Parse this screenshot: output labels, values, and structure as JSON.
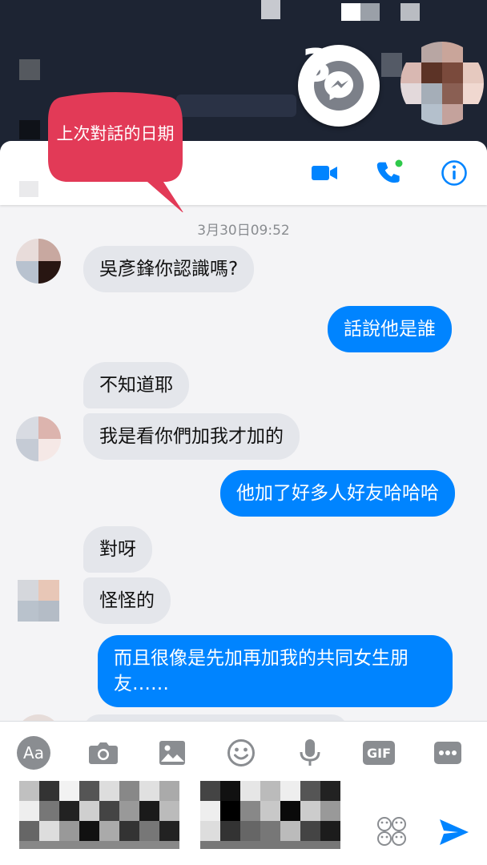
{
  "annotation": {
    "text": "上次對話的日期"
  },
  "thread": {
    "timestamp": "3月30日09:52"
  },
  "messages": [
    {
      "side": "in",
      "text": "吳彥鋒你認識嗎?"
    },
    {
      "side": "out",
      "text": "話說他是誰"
    },
    {
      "side": "in",
      "text": "不知道耶"
    },
    {
      "side": "in",
      "text": "我是看你們加我才加的"
    },
    {
      "side": "out",
      "text": "他加了好多人好友哈哈哈"
    },
    {
      "side": "in",
      "text": "對呀"
    },
    {
      "side": "in",
      "text": "怪怪的"
    },
    {
      "side": "out",
      "text": "而且很像是先加再加我的共同女生朋友……"
    }
  ],
  "composer": {
    "aa_label": "Aa",
    "gif_label": "GIF"
  },
  "chathead": {
    "badge": "3"
  },
  "colors": {
    "accent": "#0084ff",
    "callout": "#e23a57",
    "incoming": "#e4e6eb"
  },
  "icons": [
    "video-call-icon",
    "voice-call-icon",
    "info-icon",
    "messenger-icon",
    "camera-icon",
    "image-icon",
    "emoji-icon",
    "microphone-icon",
    "gif-icon",
    "more-icon",
    "sticker-icon",
    "send-icon"
  ]
}
